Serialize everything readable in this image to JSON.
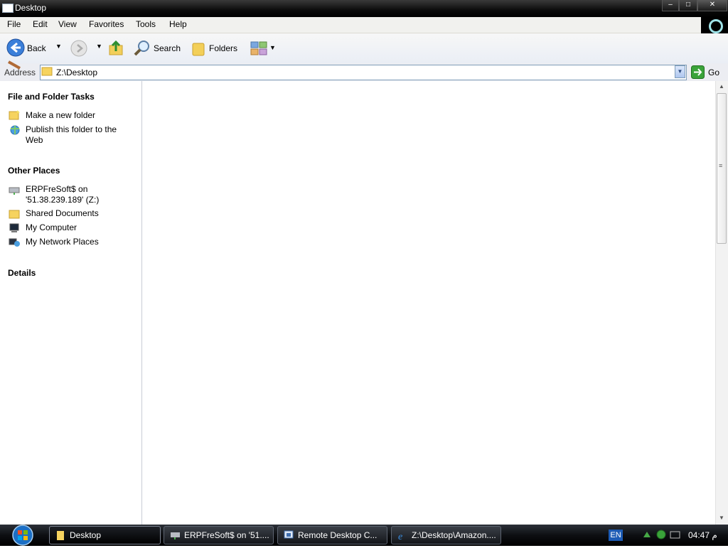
{
  "window": {
    "title": "Desktop"
  },
  "menu": [
    "File",
    "Edit",
    "View",
    "Favorites",
    "Tools",
    "Help"
  ],
  "toolbar": {
    "back": "Back",
    "search": "Search",
    "folders": "Folders"
  },
  "address": {
    "label": "Address",
    "value": "Z:\\Desktop",
    "go": "Go"
  },
  "tasks": {
    "file_folder_title": "File and Folder Tasks",
    "file_folder_items": [
      "Make a new folder",
      "Publish this folder to the",
      "Web"
    ],
    "other_places_title": "Other Places",
    "other_places_items": [
      "ERPFreSoft$ on",
      "'51.38.239.189' (Z:)",
      "Shared Documents",
      "My Computer",
      "My Network Places"
    ],
    "details_title": "Details"
  },
  "taskbar": {
    "items": [
      "Desktop",
      "ERPFreSoft$ on '51....",
      "Remote Desktop C...",
      "Z:\\Desktop\\Amazon...."
    ],
    "language": "EN",
    "clock": "04:47 م"
  },
  "colors": {
    "accent": "#2b5fb8",
    "taskbar": "#0d0f12"
  }
}
